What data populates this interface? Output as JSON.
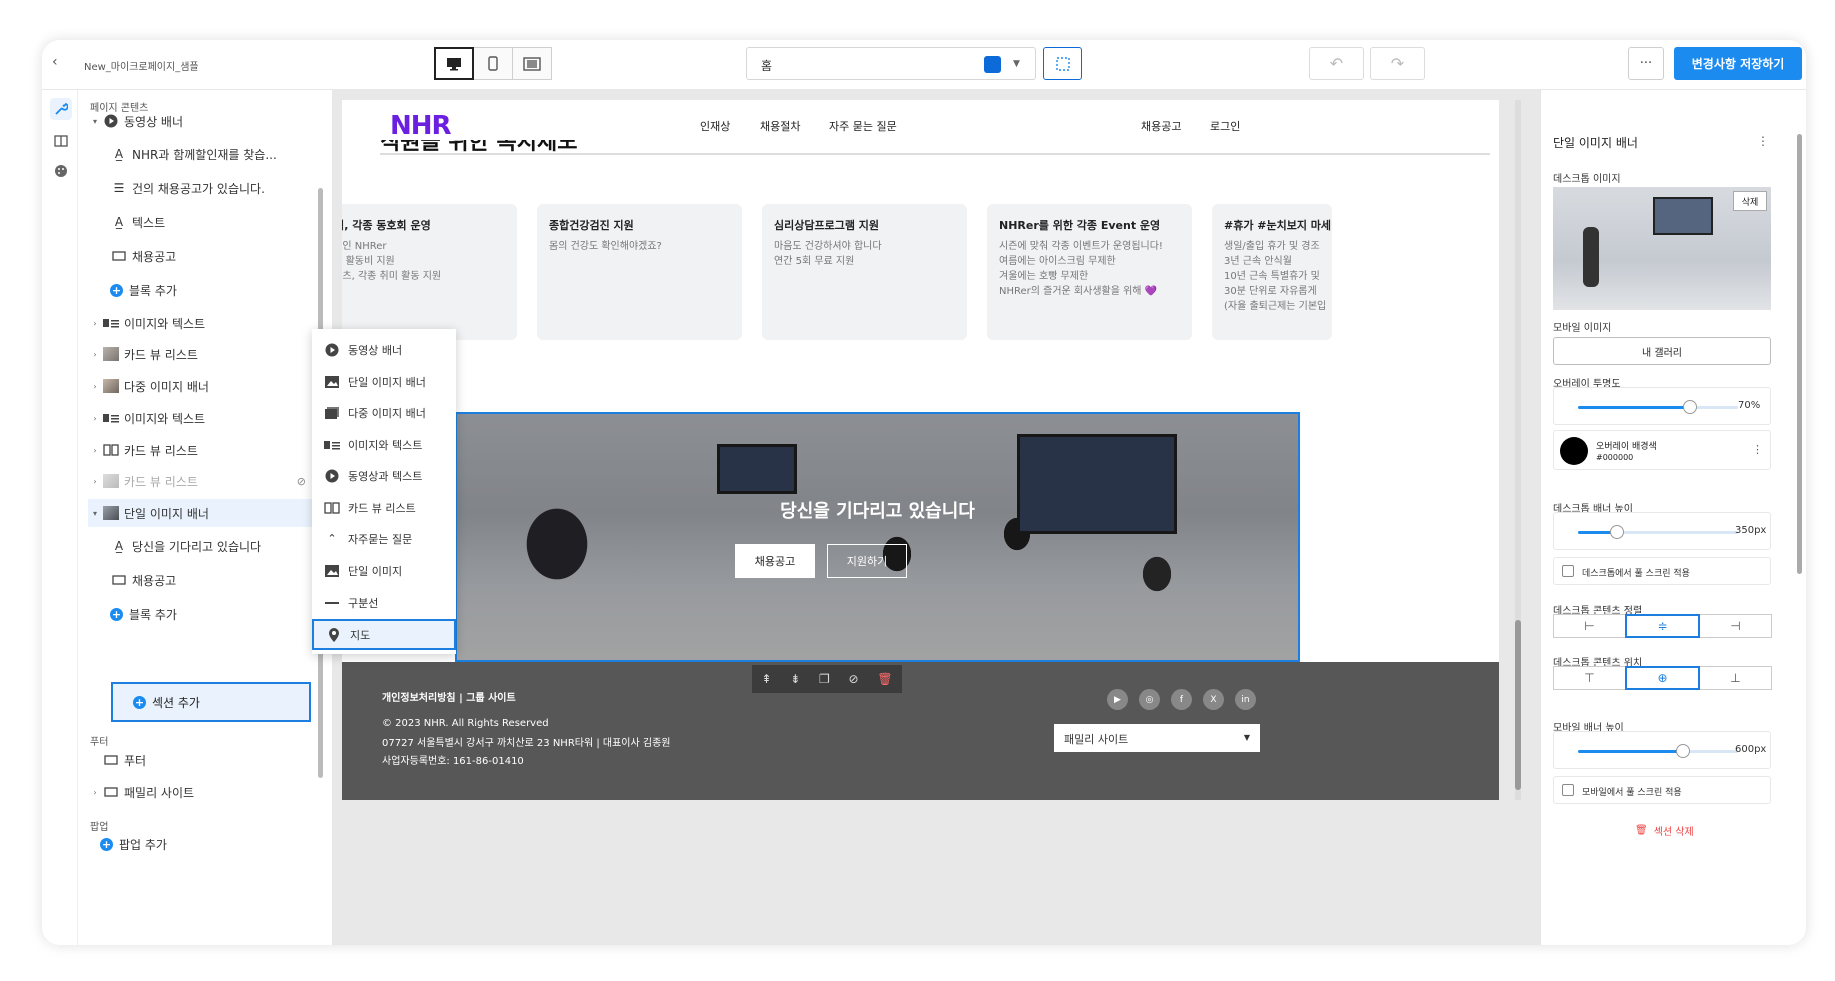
{
  "topbar": {
    "title": "New_마이크로페이지_샘플",
    "page_select": "홈",
    "save_label": "변경사항 저장하기",
    "more": "···"
  },
  "left_panel": {
    "section_page": "페이지 콘텐츠",
    "items": [
      {
        "label": "동영상 배너"
      },
      {
        "label": "NHR과 함께할인재를 찾습..."
      },
      {
        "label": "건의 채용공고가 있습니다."
      },
      {
        "label": "텍스트"
      },
      {
        "label": "채용공고"
      },
      {
        "label": "블록 추가"
      },
      {
        "label": "이미지와 텍스트"
      },
      {
        "label": "카드 뷰 리스트"
      },
      {
        "label": "다중 이미지 배너"
      },
      {
        "label": "이미지와 텍스트"
      },
      {
        "label": "카드 뷰 리스트"
      },
      {
        "label": "카드 뷰 리스트"
      },
      {
        "label": "단일 이미지 배너"
      },
      {
        "label": "당신을 기다리고 있습니다"
      },
      {
        "label": "채용공고"
      },
      {
        "label": "블록 추가"
      }
    ],
    "add_section": "섹션 추가",
    "section_footer": "푸터",
    "footer_items": [
      {
        "label": "푸터"
      },
      {
        "label": "패밀리 사이트"
      }
    ],
    "section_popup": "팝업",
    "add_popup": "팝업 추가"
  },
  "popup_menu": {
    "items": [
      {
        "label": "동영상 배너"
      },
      {
        "label": "단일 이미지 배너"
      },
      {
        "label": "다중 이미지 배너"
      },
      {
        "label": "이미지와 텍스트"
      },
      {
        "label": "동영상과 텍스트"
      },
      {
        "label": "카드 뷰 리스트"
      },
      {
        "label": "자주묻는 질문"
      },
      {
        "label": "단일 이미지"
      },
      {
        "label": "구분선"
      },
      {
        "label": "지도"
      }
    ]
  },
  "site": {
    "logo": "NHR",
    "nav": [
      {
        "label": "인재상"
      },
      {
        "label": "채용절차"
      },
      {
        "label": "자주 묻는 질문"
      }
    ],
    "nav_right": [
      {
        "label": "채용공고"
      },
      {
        "label": "로그인"
      }
    ],
    "clipped_heading": "직원을 위한 복지제도",
    "cards": [
      {
        "title": "진심, 각종 동호회 운영",
        "lines": [
          "진심인 NHRer",
          "호회 활동비 지원",
          "스포츠, 각종 취미 활동 지원"
        ]
      },
      {
        "title": "종합건강검진 지원",
        "lines": [
          "몸의 건강도 확인해야겠죠?"
        ]
      },
      {
        "title": "심리상담프로그램 지원",
        "lines": [
          "마음도 건강하셔야 합니다",
          "연간 5회 무료 지원"
        ]
      },
      {
        "title": "NHRer를 위한 각종 Event 운영",
        "lines": [
          "시즌에 맞춰 각종 이벤트가 운영됩니다!",
          "여름에는 아이스크림 무제한",
          "겨울에는 호빵 무제한",
          "NHRer의 즐거운 회사생활을 위해 💜"
        ]
      },
      {
        "title": "#휴가 #눈치보지 마세",
        "lines": [
          "생일/출입 휴가 및 경조",
          "3년 근속 안식월",
          "10년 근속 특별휴가 및",
          "30분 단위로 자유롭게",
          "(자율 출퇴근제는 기본입"
        ]
      }
    ],
    "banner": {
      "title": "당신을 기다리고 있습니다",
      "btn1": "채용공고",
      "btn2": "지원하기"
    },
    "footer": {
      "links": "개인정보처리방침    |    그룹 사이트",
      "copyright": "© 2023 NHR. All Rights Reserved",
      "address": "07727 서울특별시 강서구 까치산로 23 NHR타워 | 대표이사 김종원",
      "biz": "사업자등록번호: 161-86-01410",
      "family_site": "패밀리 사이트",
      "social": [
        "youtube-icon",
        "instagram-icon",
        "facebook-icon",
        "x-icon",
        "linkedin-icon"
      ]
    }
  },
  "right_panel": {
    "title": "단일 이미지 배너",
    "desktop_image": "데스크톱 이미지",
    "delete": "삭제",
    "mobile_image": "모바일 이미지",
    "gallery": "내 갤러리",
    "overlay_opacity": "오버레이 투명도",
    "overlay_value": "70%",
    "overlay_opacity_fraction": 0.7,
    "overlay_color_label": "오버레이 배경색",
    "overlay_color": "#000000",
    "desktop_banner_height": "데스크톱 배너 높이",
    "desktop_height_value": "350px",
    "fullscreen_desktop": "데스크톱에서 풀 스크린 적용",
    "desktop_content_align": "데스크톱 콘텐츠 정렬",
    "desktop_content_position": "데스크톱 콘텐츠 위치",
    "mobile_banner_height": "모바일 배너 높이",
    "mobile_height_value": "600px",
    "fullscreen_mobile": "모바일에서 풀 스크린 적용",
    "delete_section": "섹션 삭제"
  }
}
